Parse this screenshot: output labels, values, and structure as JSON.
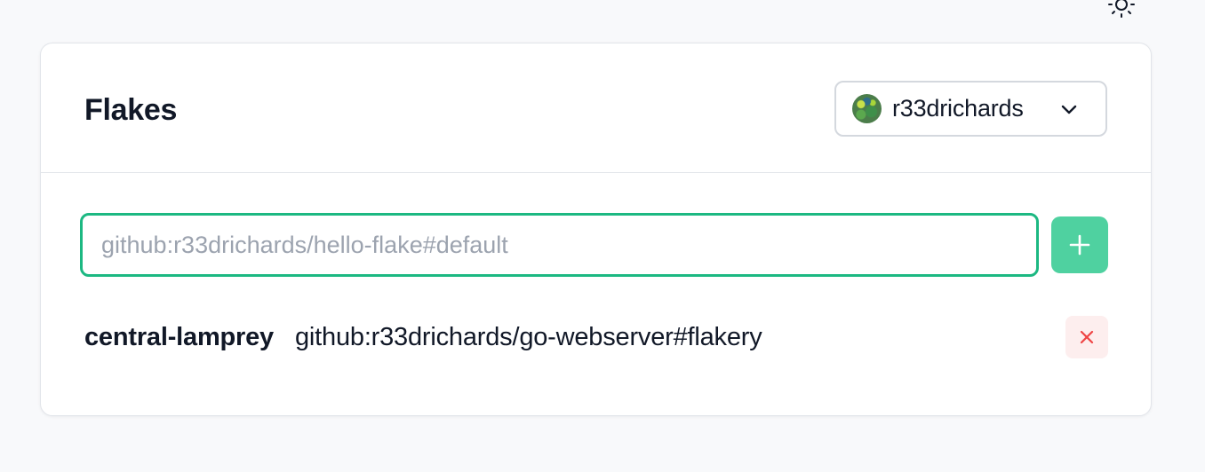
{
  "header": {
    "theme_toggle_icon": "sun-icon"
  },
  "card": {
    "title": "Flakes",
    "user_select": {
      "username": "r33drichards",
      "avatar_icon": "avatar",
      "dropdown_icon": "chevron-down-icon"
    },
    "add_flake": {
      "placeholder": "github:r33drichards/hello-flake#default",
      "value": "",
      "button_icon": "plus-icon",
      "accent_color": "#1cb882",
      "button_color": "#4fd1a0"
    },
    "flakes": [
      {
        "name": "central-lamprey",
        "ref": "github:r33drichards/go-webserver#flakery",
        "delete_icon": "close-icon",
        "delete_color": "#ef4444"
      }
    ]
  }
}
